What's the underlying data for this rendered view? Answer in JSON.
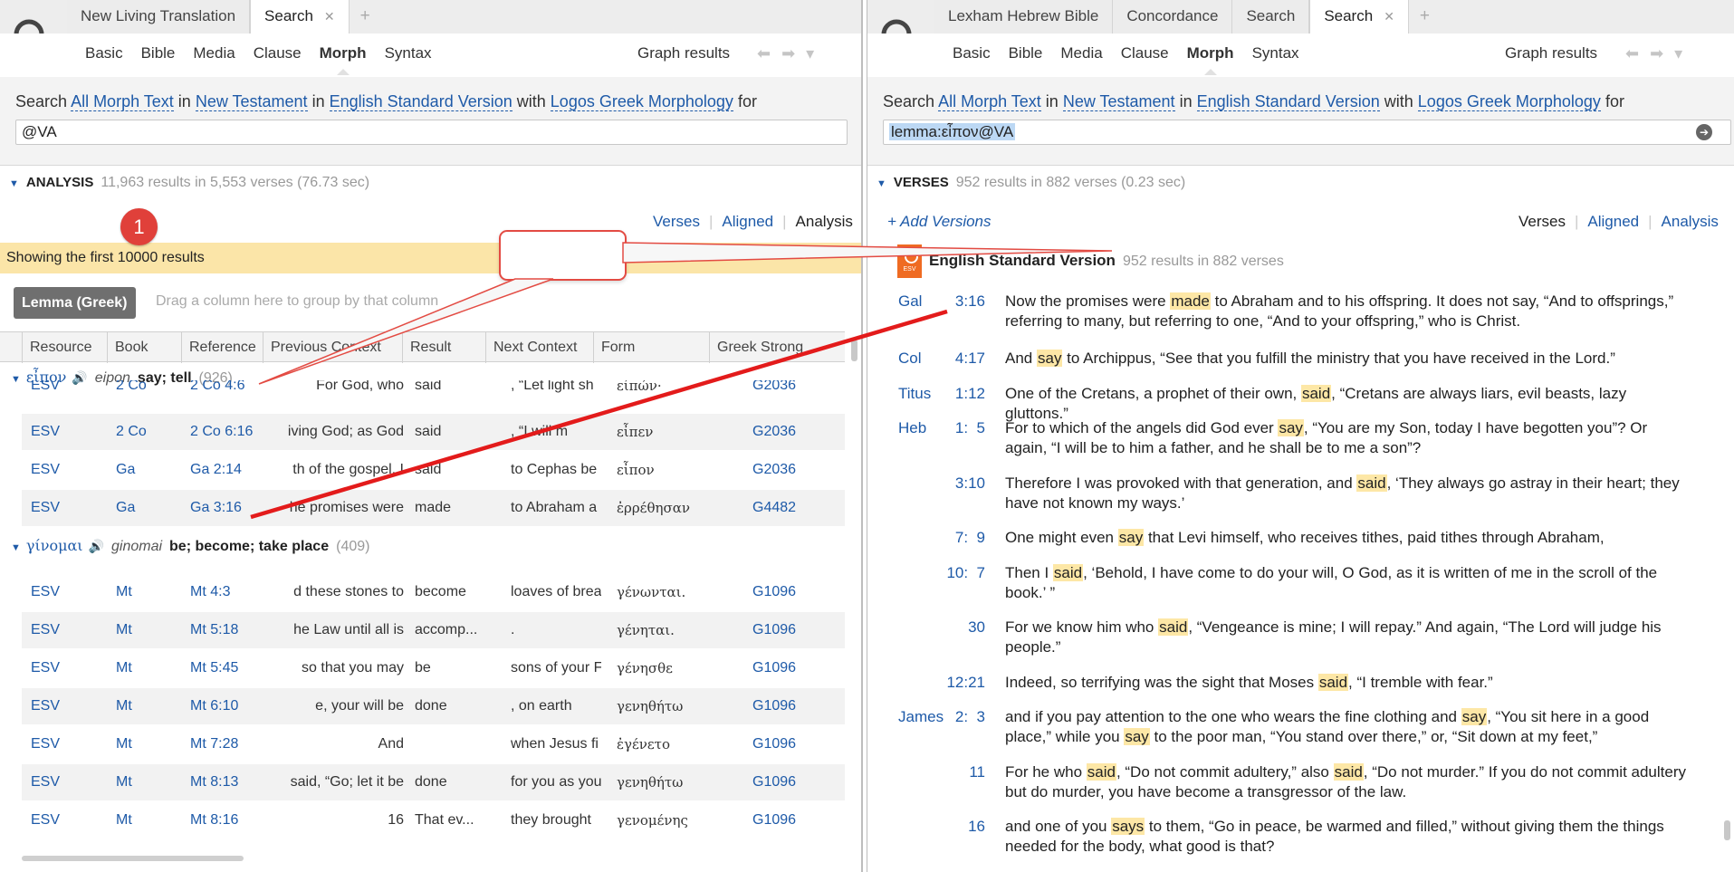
{
  "left": {
    "tabs": [
      {
        "label": "New Living Translation",
        "active": false
      },
      {
        "label": "Search",
        "active": true
      }
    ],
    "subtabs": [
      "Basic",
      "Bible",
      "Media",
      "Clause",
      "Morph",
      "Syntax"
    ],
    "active_subtab": "Morph",
    "graph_results": "Graph results",
    "search": {
      "prefix": "Search",
      "field": "All Morph Text",
      "in1": "in",
      "range": "New Testament",
      "in2": "in",
      "version": "English Standard Version",
      "with": "with",
      "morphology": "Logos Greek Morphology",
      "for": "for",
      "query": "@VA"
    },
    "section": {
      "title": "ANALYSIS",
      "meta": "11,963 results in 5,553 verses (76.73 sec)"
    },
    "view_links": [
      "Verses",
      "Aligned",
      "Analysis"
    ],
    "current_view": "Analysis",
    "badge": "1",
    "banner": "Showing the first 10000 results",
    "group_chip": "Lemma (Greek)",
    "drag_hint": "Drag a column here to group by that column",
    "columns": [
      "Resource",
      "Book",
      "Reference",
      "Previous Context",
      "Result",
      "Next Context",
      "Form",
      "Greek Strong"
    ],
    "groups": [
      {
        "lemma": "εἶπον",
        "translit": "eipon",
        "gloss": "say; tell",
        "count": "(926)",
        "rows": [
          {
            "resource": "ESV",
            "book": "2 Co",
            "reference": "2 Co 4:6",
            "prev": "For God, who",
            "result": "said",
            "next": ", “Let light sh",
            "form": "εἰπών·",
            "strong": "G2036"
          },
          {
            "resource": "ESV",
            "book": "2 Co",
            "reference": "2 Co 6:16",
            "prev": "iving God; as God",
            "result": "said",
            "next": ", “I will m",
            "form": "εἶπεν",
            "strong": "G2036"
          },
          {
            "resource": "ESV",
            "book": "Ga",
            "reference": "Ga 2:14",
            "prev": "th of the gospel, I",
            "result": "said",
            "next": "to Cephas be",
            "form": "εἶπον",
            "strong": "G2036"
          },
          {
            "resource": "ESV",
            "book": "Ga",
            "reference": "Ga 3:16",
            "prev": "he promises were",
            "result": "made",
            "next": "to Abraham a",
            "form": "ἐρρέθησαν",
            "strong": "G4482"
          }
        ]
      },
      {
        "lemma": "γίνομαι",
        "translit": "ginomai",
        "gloss": "be; become; take place",
        "count": "(409)",
        "rows": [
          {
            "resource": "ESV",
            "book": "Mt",
            "reference": "Mt 4:3",
            "prev": "d these stones to",
            "result": "become",
            "next": "loaves of brea",
            "form": "γένωνται.",
            "strong": "G1096"
          },
          {
            "resource": "ESV",
            "book": "Mt",
            "reference": "Mt 5:18",
            "prev": "he Law until all is",
            "result": "accomp...",
            "next": ".",
            "form": "γένηται.",
            "strong": "G1096"
          },
          {
            "resource": "ESV",
            "book": "Mt",
            "reference": "Mt 5:45",
            "prev": "so that you may",
            "result": "be",
            "next": "sons of your F",
            "form": "γένησθε",
            "strong": "G1096"
          },
          {
            "resource": "ESV",
            "book": "Mt",
            "reference": "Mt 6:10",
            "prev": "e,      your will be",
            "result": "done",
            "next": ",      on earth",
            "form": "γενηθήτω",
            "strong": "G1096"
          },
          {
            "resource": "ESV",
            "book": "Mt",
            "reference": "Mt 7:28",
            "prev": "And",
            "result": "",
            "next": "when Jesus fi",
            "form": "ἐγένετο",
            "strong": "G1096"
          },
          {
            "resource": "ESV",
            "book": "Mt",
            "reference": "Mt 8:13",
            "prev": "said, “Go; let it be",
            "result": "done",
            "next": "for you as you",
            "form": "γενηθήτω",
            "strong": "G1096"
          },
          {
            "resource": "ESV",
            "book": "Mt",
            "reference": "Mt 8:16",
            "prev": "16",
            "result": "That ev...",
            "next": "they brought",
            "form": "γενομένης",
            "strong": "G1096"
          }
        ]
      }
    ]
  },
  "right": {
    "tabs": [
      {
        "label": "Lexham Hebrew Bible",
        "active": false
      },
      {
        "label": "Concordance",
        "active": false
      },
      {
        "label": "Search",
        "active": false
      },
      {
        "label": "Search",
        "active": true
      }
    ],
    "subtabs": [
      "Basic",
      "Bible",
      "Media",
      "Clause",
      "Morph",
      "Syntax"
    ],
    "active_subtab": "Morph",
    "graph_results": "Graph results",
    "search": {
      "prefix": "Search",
      "field": "All Morph Text",
      "in1": "in",
      "range": "New Testament",
      "in2": "in",
      "version": "English Standard Version",
      "with": "with",
      "morphology": "Logos Greek Morphology",
      "for": "for",
      "query": "lemma:εἶπον@VA"
    },
    "section": {
      "title": "VERSES",
      "meta": "952 results in 882 verses (0.23 sec)"
    },
    "add_versions": "+ Add Versions",
    "view_links": [
      "Verses",
      "Aligned",
      "Analysis"
    ],
    "current_view": "Verses",
    "version_name": "English Standard Version",
    "version_meta": "952 results in 882 verses",
    "esv_logo": "ESV",
    "verses": [
      {
        "book": "Gal",
        "ref": "3:16",
        "parts": [
          "Now the promises were ",
          "made",
          " to Abraham and to his offspring. It does not say, “And to offsprings,” referring to many, but referring to one, “And to your offspring,” who is Christ."
        ]
      },
      {
        "book": "Col",
        "ref": "4:17",
        "parts": [
          "And ",
          "say",
          " to Archippus, “See that you fulfill the ministry that you have received in the Lord.”"
        ]
      },
      {
        "book": "Titus",
        "ref": "1:12",
        "parts": [
          "One of the Cretans, a prophet of their own, ",
          "said",
          ", “Cretans are always liars, evil beasts, lazy gluttons.”"
        ]
      },
      {
        "book": "Heb",
        "ref": "1:  5",
        "parts": [
          "For to which of the angels did God ever ",
          "say",
          ", “You are my Son, today I have begotten you”? Or again, “I will be to him a father, and he shall be to me a son”?"
        ]
      },
      {
        "book": "",
        "ref": "3:10",
        "parts": [
          "Therefore I was provoked with that generation, and ",
          "said",
          ", ‘They always go astray in their heart; they have not known my ways.’"
        ]
      },
      {
        "book": "",
        "ref": "7:  9",
        "parts": [
          "One might even ",
          "say",
          " that Levi himself, who receives tithes, paid tithes through Abraham,"
        ]
      },
      {
        "book": "",
        "ref": "10:  7",
        "parts": [
          "Then I ",
          "said",
          ", ‘Behold, I have come to do your will, O God, as it is written of me in the scroll of the book.’ ”"
        ]
      },
      {
        "book": "",
        "ref": "30",
        "parts": [
          "For we know him who ",
          "said",
          ", “Vengeance is mine; I will repay.” And again, “The Lord will judge his people.”"
        ]
      },
      {
        "book": "",
        "ref": "12:21",
        "parts": [
          "Indeed, so terrifying was the sight that Moses ",
          "said",
          ", “I tremble with fear.”"
        ]
      },
      {
        "book": "James",
        "ref": "2:  3",
        "parts": [
          "and if you pay attention to the one who wears the fine clothing and ",
          "say",
          ", “You sit here in a good place,” while you ",
          "say",
          " to the poor man, “You stand over there,” or, “Sit down at my feet,”"
        ]
      },
      {
        "book": "",
        "ref": "11",
        "parts": [
          "For he who ",
          "said",
          ", “Do not commit adultery,” also ",
          "said",
          ", “Do not murder.” If you do not commit adultery but do murder, you have become a transgressor of the law."
        ]
      },
      {
        "book": "",
        "ref": "16",
        "parts": [
          "and one of you ",
          "says",
          " to them, “Go in peace, be warmed and filled,” without giving them the things needed for the body, what good is that?"
        ]
      }
    ]
  },
  "colors": {
    "link": "#1e5aa8",
    "highlight": "#fde7a6",
    "banner": "#fbe5a8",
    "annotation": "#e31b1b"
  }
}
